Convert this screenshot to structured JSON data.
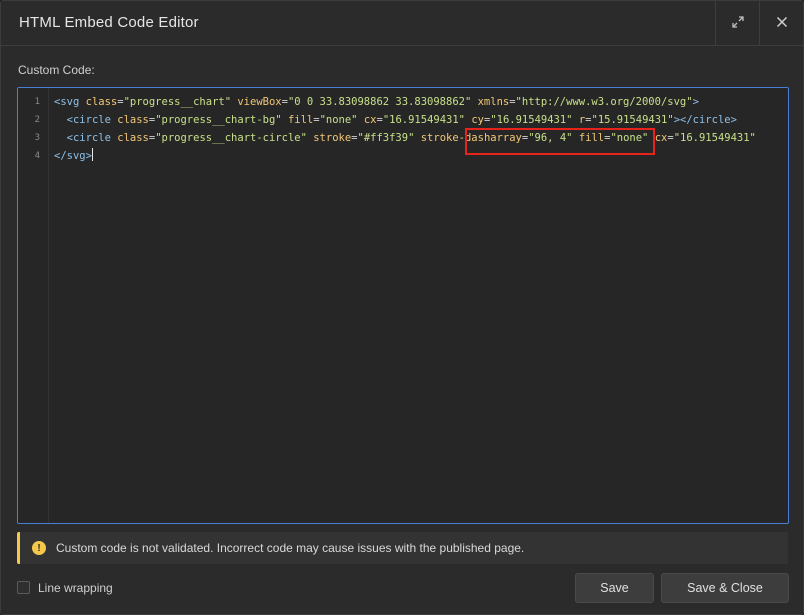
{
  "window": {
    "title": "HTML Embed Code Editor"
  },
  "icons": {
    "expand": "expand-arrows-icon",
    "close": "close-x-icon",
    "warning": "info-exclamation-icon"
  },
  "editor": {
    "label": "Custom Code:",
    "line_numbers": [
      "1",
      "2",
      "3",
      "4"
    ],
    "lines": [
      [
        {
          "t": "tag",
          "s": "<svg"
        },
        {
          "t": "plain",
          "s": " "
        },
        {
          "t": "attr",
          "s": "class"
        },
        {
          "t": "plain",
          "s": "="
        },
        {
          "t": "val",
          "s": "\"progress__chart\""
        },
        {
          "t": "plain",
          "s": " "
        },
        {
          "t": "attr",
          "s": "viewBox"
        },
        {
          "t": "plain",
          "s": "="
        },
        {
          "t": "val",
          "s": "\"0 0 33.83098862 33.83098862\""
        },
        {
          "t": "plain",
          "s": " "
        },
        {
          "t": "attr",
          "s": "xmlns"
        },
        {
          "t": "plain",
          "s": "="
        },
        {
          "t": "val",
          "s": "\"http://www.w3.org/2000/svg\""
        },
        {
          "t": "tag",
          "s": ">"
        }
      ],
      [
        {
          "t": "plain",
          "s": "  "
        },
        {
          "t": "tag",
          "s": "<circle"
        },
        {
          "t": "plain",
          "s": " "
        },
        {
          "t": "attr",
          "s": "class"
        },
        {
          "t": "plain",
          "s": "="
        },
        {
          "t": "val",
          "s": "\"progress__chart-bg\""
        },
        {
          "t": "plain",
          "s": " "
        },
        {
          "t": "attr",
          "s": "fill"
        },
        {
          "t": "plain",
          "s": "="
        },
        {
          "t": "val",
          "s": "\"none\""
        },
        {
          "t": "plain",
          "s": " "
        },
        {
          "t": "attr",
          "s": "cx"
        },
        {
          "t": "plain",
          "s": "="
        },
        {
          "t": "val",
          "s": "\"16.91549431\""
        },
        {
          "t": "plain",
          "s": " "
        },
        {
          "t": "attr",
          "s": "cy"
        },
        {
          "t": "plain",
          "s": "="
        },
        {
          "t": "val",
          "s": "\"16.91549431\""
        },
        {
          "t": "plain",
          "s": " "
        },
        {
          "t": "attr",
          "s": "r"
        },
        {
          "t": "plain",
          "s": "="
        },
        {
          "t": "val",
          "s": "\"15.91549431\""
        },
        {
          "t": "tag",
          "s": "></circle>"
        }
      ],
      [
        {
          "t": "plain",
          "s": "  "
        },
        {
          "t": "tag",
          "s": "<circle"
        },
        {
          "t": "plain",
          "s": " "
        },
        {
          "t": "attr",
          "s": "class"
        },
        {
          "t": "plain",
          "s": "="
        },
        {
          "t": "val",
          "s": "\"progress__chart-circle\""
        },
        {
          "t": "plain",
          "s": " "
        },
        {
          "t": "attr",
          "s": "stroke"
        },
        {
          "t": "plain",
          "s": "="
        },
        {
          "t": "val",
          "s": "\"#ff3f39\""
        },
        {
          "t": "plain",
          "s": " "
        },
        {
          "t": "attr",
          "s": "stroke-dasharray"
        },
        {
          "t": "plain",
          "s": "="
        },
        {
          "t": "val",
          "s": "\"96, 4\""
        },
        {
          "t": "plain",
          "s": " "
        },
        {
          "t": "attr",
          "s": "fill"
        },
        {
          "t": "plain",
          "s": "="
        },
        {
          "t": "val",
          "s": "\"none\""
        },
        {
          "t": "plain",
          "s": " "
        },
        {
          "t": "attr",
          "s": "cx"
        },
        {
          "t": "plain",
          "s": "="
        },
        {
          "t": "val",
          "s": "\"16.91549431\""
        }
      ],
      [
        {
          "t": "tag",
          "s": "</svg>"
        }
      ]
    ]
  },
  "warning": {
    "text": "Custom code is not validated. Incorrect code may cause issues with the published page."
  },
  "footer": {
    "line_wrapping_label": "Line wrapping",
    "save_label": "Save",
    "save_close_label": "Save & Close"
  },
  "colors": {
    "accent_border": "#4a7fd6",
    "highlight_box": "#e8231b",
    "warning": "#f5c84a",
    "syntax_tag": "#8ec0e8",
    "syntax_attr": "#f2c777",
    "syntax_value": "#c7e08a"
  }
}
